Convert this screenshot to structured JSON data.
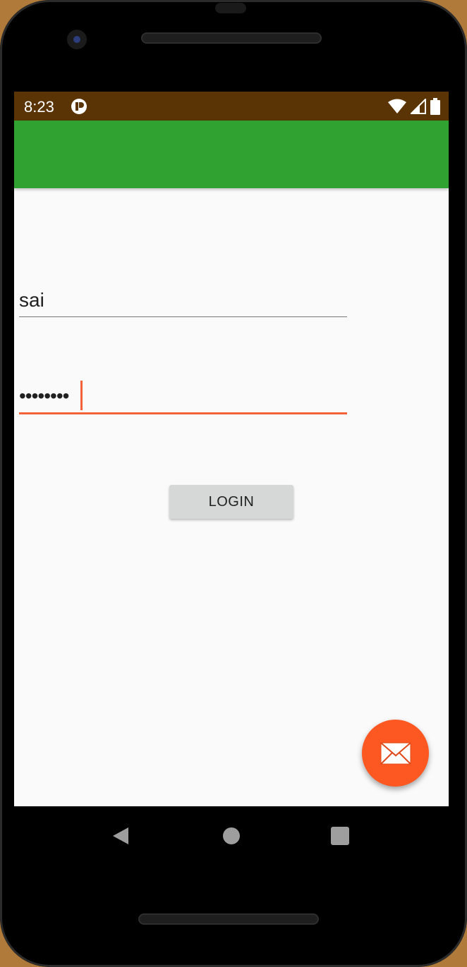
{
  "status_bar": {
    "time": "8:23",
    "background_color": "#5a3404",
    "icons": [
      "notification-icon",
      "wifi-icon",
      "cell-signal-icon",
      "battery-icon"
    ]
  },
  "app_bar": {
    "background_color": "#30a232"
  },
  "form": {
    "username_value": "sai",
    "password_value": "••••••••",
    "accent_color": "#f4623a",
    "login_label": "LOGIN"
  },
  "fab": {
    "icon": "mail-icon",
    "color": "#fd5722"
  },
  "nav_bar": {
    "buttons": [
      "back-icon",
      "home-icon",
      "recents-icon"
    ]
  }
}
